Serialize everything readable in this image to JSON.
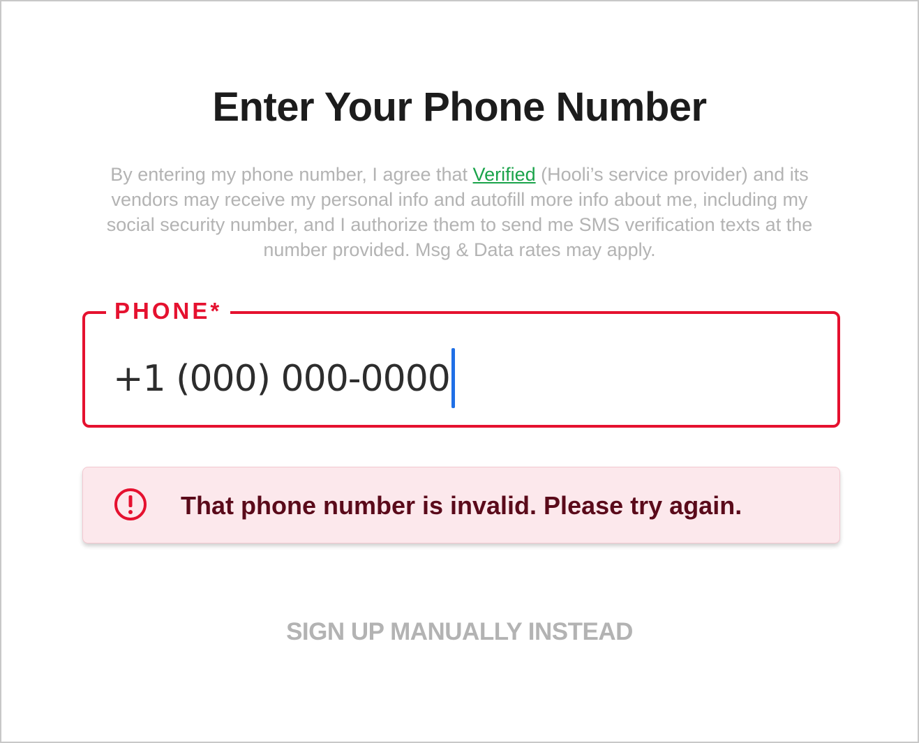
{
  "header": {
    "title": "Enter Your Phone Number"
  },
  "disclaimer": {
    "before_link": "By entering my phone number, I agree that ",
    "link_text": "Verified",
    "after_link": " (Hooli’s service provider) and its vendors may receive my personal info and autofill more info about me, including my social security number, and I authorize them to send me SMS verification texts at the number provided. Msg & Data rates may apply."
  },
  "phone_field": {
    "label": "PHONE*",
    "value": "+1 (000) 000-0000",
    "state": "error"
  },
  "error_banner": {
    "icon": "alert-circle-icon",
    "message": "That phone number is invalid. Please try again."
  },
  "footer": {
    "manual_signup_label": "SIGN UP MANUALLY INSTEAD"
  },
  "colors": {
    "error_red": "#e5112f",
    "link_green": "#1aa34a",
    "caret_blue": "#1f6fe6",
    "banner_bg": "#fce8ec",
    "muted_text": "#b3b3b3"
  }
}
